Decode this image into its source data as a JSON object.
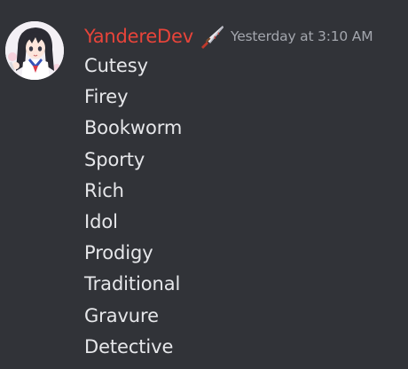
{
  "message": {
    "author": {
      "name": "YandereDev",
      "name_color": "#e8443a",
      "avatar_icon": "anime-girl-avatar",
      "role_icon": "knife-icon"
    },
    "timestamp": "Yesterday at 3:10 AM",
    "lines": [
      "Cutesy",
      "Firey",
      "Bookworm",
      "Sporty",
      "Rich",
      "Idol",
      "Prodigy",
      "Traditional",
      "Gravure",
      "Detective"
    ]
  },
  "theme": {
    "background": "#313338",
    "text": "#e6e7ea",
    "muted": "#a3a6ad"
  }
}
